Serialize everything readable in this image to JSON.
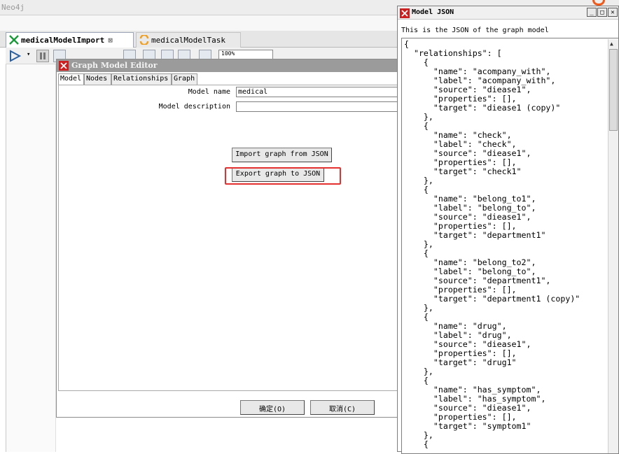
{
  "app": {
    "title": "Neo4j"
  },
  "editor_tabs": [
    {
      "label": "medicalModelImport",
      "active": true
    },
    {
      "label": "medicalModelTask",
      "active": false
    }
  ],
  "toolbar": {
    "zoom": "100%"
  },
  "graph_model_editor": {
    "title": "Graph Model Editor",
    "tabs": [
      "Model",
      "Nodes",
      "Relationships",
      "Graph"
    ],
    "selected_tab": "Model",
    "model_name_label": "Model name",
    "model_name_value": "medical",
    "model_description_label": "Model description",
    "model_description_value": "",
    "import_button": "Import graph from JSON",
    "export_button": "Export graph to JSON",
    "ok_button": "确定(O)",
    "cancel_button": "取消(C)"
  },
  "model_json_window": {
    "title": "Model JSON",
    "caption": "This is the JSON of the graph model",
    "json_text": "{\n  \"relationships\": [\n    {\n      \"name\": \"acompany_with\",\n      \"label\": \"acompany_with\",\n      \"source\": \"diease1\",\n      \"properties\": [],\n      \"target\": \"diease1 (copy)\"\n    },\n    {\n      \"name\": \"check\",\n      \"label\": \"check\",\n      \"source\": \"diease1\",\n      \"properties\": [],\n      \"target\": \"check1\"\n    },\n    {\n      \"name\": \"belong_to1\",\n      \"label\": \"belong_to\",\n      \"source\": \"diease1\",\n      \"properties\": [],\n      \"target\": \"department1\"\n    },\n    {\n      \"name\": \"belong_to2\",\n      \"label\": \"belong_to\",\n      \"source\": \"department1\",\n      \"properties\": [],\n      \"target\": \"department1 (copy)\"\n    },\n    {\n      \"name\": \"drug\",\n      \"label\": \"drug\",\n      \"source\": \"diease1\",\n      \"properties\": [],\n      \"target\": \"drug1\"\n    },\n    {\n      \"name\": \"has_symptom\",\n      \"label\": \"has_symptom\",\n      \"source\": \"diease1\",\n      \"properties\": [],\n      \"target\": \"symptom1\"\n    },\n    {"
  },
  "colors": {
    "highlight": "#e53030",
    "dialog_title": "#9b9b9b",
    "app_icon": "#cc1f1f"
  }
}
